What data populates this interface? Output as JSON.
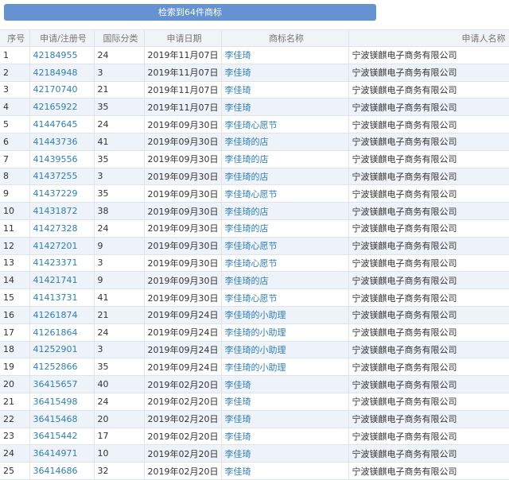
{
  "search_result_button": "检索到64件商标",
  "columns": [
    "序号",
    "申请/注册号",
    "国际分类",
    "申请日期",
    "商标名称",
    "申请人名称"
  ],
  "rows": [
    [
      "1",
      "42184955",
      "24",
      "2019年11月07日",
      "李佳琦",
      "宁波镁麒电子商务有限公司"
    ],
    [
      "2",
      "42184948",
      "3",
      "2019年11月07日",
      "李佳琦",
      "宁波镁麒电子商务有限公司"
    ],
    [
      "3",
      "42170740",
      "21",
      "2019年11月07日",
      "李佳琦",
      "宁波镁麒电子商务有限公司"
    ],
    [
      "4",
      "42165922",
      "35",
      "2019年11月07日",
      "李佳琦",
      "宁波镁麒电子商务有限公司"
    ],
    [
      "5",
      "41447645",
      "24",
      "2019年09月30日",
      "李佳琦心愿节",
      "宁波镁麒电子商务有限公司"
    ],
    [
      "6",
      "41443736",
      "41",
      "2019年09月30日",
      "李佳琦的店",
      "宁波镁麒电子商务有限公司"
    ],
    [
      "7",
      "41439556",
      "35",
      "2019年09月30日",
      "李佳琦的店",
      "宁波镁麒电子商务有限公司"
    ],
    [
      "8",
      "41437255",
      "3",
      "2019年09月30日",
      "李佳琦的店",
      "宁波镁麒电子商务有限公司"
    ],
    [
      "9",
      "41437229",
      "35",
      "2019年09月30日",
      "李佳琦心愿节",
      "宁波镁麒电子商务有限公司"
    ],
    [
      "10",
      "41431872",
      "38",
      "2019年09月30日",
      "李佳琦的店",
      "宁波镁麒电子商务有限公司"
    ],
    [
      "11",
      "41427328",
      "24",
      "2019年09月30日",
      "李佳琦的店",
      "宁波镁麒电子商务有限公司"
    ],
    [
      "12",
      "41427201",
      "9",
      "2019年09月30日",
      "李佳琦心愿节",
      "宁波镁麒电子商务有限公司"
    ],
    [
      "13",
      "41423371",
      "3",
      "2019年09月30日",
      "李佳琦心愿节",
      "宁波镁麒电子商务有限公司"
    ],
    [
      "14",
      "41421741",
      "9",
      "2019年09月30日",
      "李佳琦的店",
      "宁波镁麒电子商务有限公司"
    ],
    [
      "15",
      "41413731",
      "41",
      "2019年09月30日",
      "李佳琦心愿节",
      "宁波镁麒电子商务有限公司"
    ],
    [
      "16",
      "41261874",
      "21",
      "2019年09月24日",
      "李佳琦的小助理",
      "宁波镁麒电子商务有限公司"
    ],
    [
      "17",
      "41261864",
      "24",
      "2019年09月24日",
      "李佳琦的小助理",
      "宁波镁麒电子商务有限公司"
    ],
    [
      "18",
      "41252901",
      "3",
      "2019年09月24日",
      "李佳琦的小助理",
      "宁波镁麒电子商务有限公司"
    ],
    [
      "19",
      "41252866",
      "35",
      "2019年09月24日",
      "李佳琦的小助理",
      "宁波镁麒电子商务有限公司"
    ],
    [
      "20",
      "36415657",
      "40",
      "2019年02月20日",
      "李佳琦",
      "宁波镁麒电子商务有限公司"
    ],
    [
      "21",
      "36415498",
      "24",
      "2019年02月20日",
      "李佳琦",
      "宁波镁麒电子商务有限公司"
    ],
    [
      "22",
      "36415468",
      "20",
      "2019年02月20日",
      "李佳琦",
      "宁波镁麒电子商务有限公司"
    ],
    [
      "23",
      "36415442",
      "17",
      "2019年02月20日",
      "李佳琦",
      "宁波镁麒电子商务有限公司"
    ],
    [
      "24",
      "36414971",
      "10",
      "2019年02月20日",
      "李佳琦",
      "宁波镁麒电子商务有限公司"
    ],
    [
      "25",
      "36414686",
      "32",
      "2019年02月20日",
      "李佳琦",
      "宁波镁麒电子商务有限公司"
    ]
  ],
  "colors": {
    "button": "#6592d0",
    "link": "#2f7fb8",
    "alt_row": "#eef3f9",
    "header_bg": "#f0f3f7"
  }
}
